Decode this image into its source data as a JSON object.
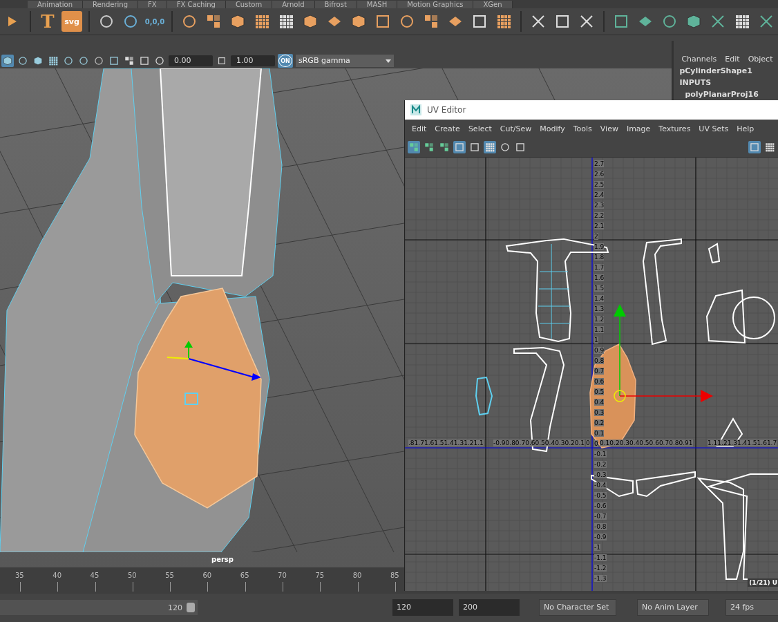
{
  "shelf_tabs": [
    "Animation",
    "Rendering",
    "FX",
    "FX Caching",
    "Custom",
    "Arnold",
    "Bifrost",
    "MASH",
    "Motion Graphics",
    "XGen"
  ],
  "shelf": {
    "labels": [
      "T",
      "svg",
      "0,0,0"
    ]
  },
  "viewport": {
    "shading_toggles": [
      {
        "selected": true
      },
      {
        "selected": false
      },
      {
        "selected": false
      },
      {
        "selected": false
      },
      {
        "selected": false
      },
      {
        "selected": false
      }
    ],
    "exposure": "0.00",
    "gamma": "1.00",
    "color_management_badge": "ON",
    "view_transform": "sRGB gamma",
    "camera_label": "persp"
  },
  "channel_box": {
    "menu": [
      "Channels",
      "Edit",
      "Object"
    ],
    "node": "pCylinderShape1",
    "section": "INPUTS",
    "inputs": [
      "polyPlanarProj16"
    ]
  },
  "uv_editor": {
    "title": "UV Editor",
    "menu": [
      "Edit",
      "Create",
      "Select",
      "Cut/Sew",
      "Modify",
      "Tools",
      "View",
      "Image",
      "Textures",
      "UV Sets",
      "Help"
    ],
    "toolbar": [
      {
        "selected": true
      },
      {
        "selected": false
      },
      {
        "selected": false
      },
      {
        "selected": true
      },
      {
        "selected": false
      },
      {
        "selected": true
      },
      {
        "selected": false
      },
      {
        "selected": false
      }
    ],
    "right_toolbar": [
      {
        "selected": true
      },
      {
        "selected": false
      }
    ],
    "v_labels": [
      "2.7",
      "2.6",
      "2.5",
      "2.4",
      "2.3",
      "2.2",
      "2.1",
      "2",
      "1.9",
      "1.8",
      "1.7",
      "1.6",
      "1.5",
      "1.4",
      "1.3",
      "1.2",
      "1.1",
      "1",
      "0.9",
      "0.8",
      "0.7",
      "0.6",
      "0.5",
      "0.4",
      "0.3",
      "0.2",
      "0.1",
      "0",
      "-0.1",
      "-0.2",
      "-0.3",
      "-0.4",
      "-0.5",
      "-0.6",
      "-0.7",
      "-0.8",
      "-0.9",
      "-1",
      "-1.1",
      "-1.2",
      "-1.3"
    ],
    "u_labels": [
      ".81.71.61.51.41.31.21.1",
      "-0.90.80.70.60.50.40.30.20.1",
      "0",
      "0.10.20.30.40.50.60.70.80.91",
      "1.11.21.31.41.51.61.7"
    ],
    "status": "(1/21) U"
  },
  "timeline": {
    "ticks": [
      "35",
      "40",
      "45",
      "50",
      "55",
      "60",
      "65",
      "70",
      "75",
      "80",
      "85"
    ]
  },
  "range_bar": {
    "level": 1,
    "range_end": "120",
    "start_field": "120",
    "end_field": "200",
    "character_set": "No Character Set",
    "anim_layer": "No Anim Layer",
    "fps": "24 fps"
  }
}
